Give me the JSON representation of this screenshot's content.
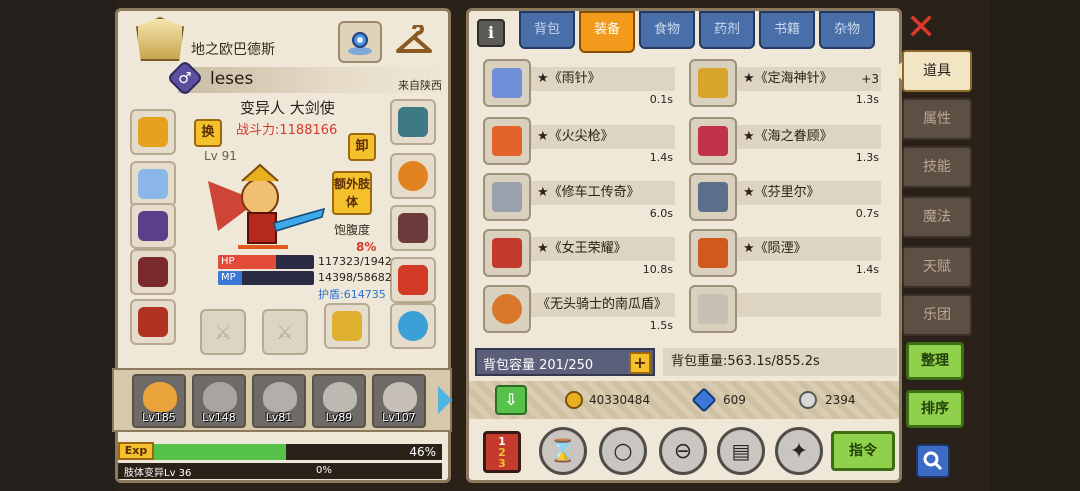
{
  "character": {
    "guild_name": "地之欧巴德斯",
    "gender_symbol": "♂",
    "player_name": "leses",
    "origin": "来自陕西",
    "race_class": "变异人 大剑使",
    "combat_power": "战斗力:1188166",
    "level_tag": "Lv 91",
    "swap_label": "换",
    "unequip_label": "卸",
    "extra_limb_label": "额外肢体",
    "satiety_label": "饱腹度",
    "satiety_value": "8%",
    "hp_label": "HP",
    "hp_value": "117323/1942",
    "hp_fraction": 0.6,
    "mp_label": "MP",
    "mp_value": "14398/58682",
    "mp_fraction": 0.25,
    "shield_value": "护盾:614735"
  },
  "party": [
    {
      "level": "Lv185",
      "active": true
    },
    {
      "level": "Lv148",
      "active": false
    },
    {
      "level": "Lv81",
      "active": false
    },
    {
      "level": "Lv89",
      "active": false
    },
    {
      "level": "Lv107",
      "active": false
    }
  ],
  "exp": {
    "label": "Exp",
    "percent": "46%",
    "fraction": 0.46,
    "limb_label": "肢体变异Lv 36",
    "limb_percent": "0%"
  },
  "inventory": {
    "tabs": [
      "背包",
      "装备",
      "食物",
      "药剂",
      "书籍",
      "杂物"
    ],
    "active_tab": "装备",
    "items": [
      {
        "name": "★《雨针》",
        "duration": "0.1s",
        "extra": "",
        "color": "#6f8fd8"
      },
      {
        "name": "★《定海神针》",
        "duration": "1.3s",
        "extra": "+3",
        "color": "#d9a42a"
      },
      {
        "name": "★《火尖枪》",
        "duration": "1.4s",
        "extra": "",
        "color": "#e2632a"
      },
      {
        "name": "★《海之眷顾》",
        "duration": "1.3s",
        "extra": "",
        "color": "#c4324a"
      },
      {
        "name": "★《修车工传奇》",
        "duration": "6.0s",
        "extra": "",
        "color": "#9aa0ad"
      },
      {
        "name": "★《芬里尔》",
        "duration": "0.7s",
        "extra": "",
        "color": "#5a6f8a"
      },
      {
        "name": "★《女王荣耀》",
        "duration": "10.8s",
        "extra": "",
        "color": "#c23a2a"
      },
      {
        "name": "★《陨湮》",
        "duration": "1.4s",
        "extra": "",
        "color": "#d05a1c"
      },
      {
        "name": "《无头骑士的南瓜盾》",
        "duration": "1.5s",
        "extra": "",
        "color": "#d9772a"
      },
      {
        "name": "",
        "duration": "",
        "extra": "",
        "color": "#c8c0b2"
      }
    ],
    "capacity": "背包容量 201/250",
    "capacity_plus": "+",
    "weight": "背包重量:563.1s/855.2s"
  },
  "currency": {
    "gold": "40330484",
    "diamond": "609",
    "silver": "2394"
  },
  "tools": {
    "command_label": "指令"
  },
  "side_menu": {
    "tabs": [
      "道具",
      "属性",
      "技能",
      "魔法",
      "天赋",
      "乐团"
    ],
    "active": "道具",
    "organize_label": "整理",
    "sort_label": "排序"
  },
  "colors": {
    "panel_bg": "#efe7d7",
    "tab_blue": "#4a6fa8",
    "tab_active": "#f29a1c",
    "power_red": "#d8392b",
    "exp_green": "#56c24a",
    "hp_red": "#e24a3a",
    "mp_blue": "#3b78d8"
  }
}
